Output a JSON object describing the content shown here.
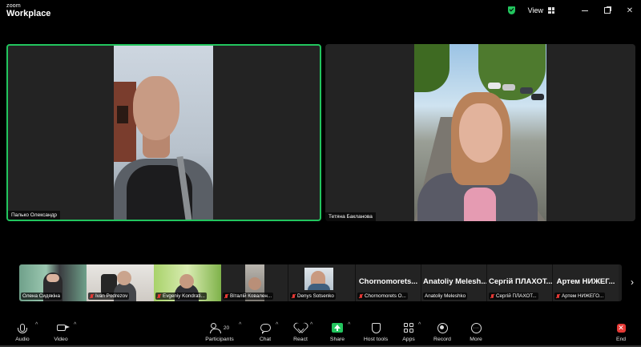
{
  "titlebar": {
    "logo_line1": "zoom",
    "logo_line2": "Workplace",
    "view_label": "View"
  },
  "main_tiles": [
    {
      "name": "Палько Олександр",
      "active": true
    },
    {
      "name": "Тетяна Бакланова",
      "active": false
    }
  ],
  "thumbnails": [
    {
      "label": "Олена Сидякіна",
      "muted": false,
      "has_video": true
    },
    {
      "label": "Ivan Podrezov",
      "muted": true,
      "has_video": true
    },
    {
      "label": "Evgeniy Kondrati...",
      "muted": true,
      "has_video": true
    },
    {
      "label": "Віталій Ковален...",
      "muted": true,
      "has_video": true
    },
    {
      "label": "Denys Sotsenko",
      "muted": true,
      "has_video": true
    },
    {
      "display_name": "Chornomorets...",
      "label": "Chornomorets O...",
      "muted": true,
      "has_video": false
    },
    {
      "display_name": "Anatoliy Melesh...",
      "label": "Anatoliy Meleshko",
      "muted": false,
      "has_video": false
    },
    {
      "display_name": "Сергій ПЛАХОТ...",
      "label": "Сергій ПЛАХОТ...",
      "muted": true,
      "has_video": false
    },
    {
      "display_name": "Артем НИЖЕГ...",
      "label": "Артем НИЖЕГО...",
      "muted": true,
      "has_video": false
    }
  ],
  "toolbar": {
    "audio": "Audio",
    "video": "Video",
    "participants": "Participants",
    "participants_count": "20",
    "chat": "Chat",
    "react": "React",
    "share": "Share",
    "host_tools": "Host tools",
    "apps": "Apps",
    "record": "Record",
    "more": "More",
    "end": "End"
  },
  "colors": {
    "accent_green": "#22c55e",
    "end_red": "#e53935",
    "background": "#000000",
    "tile": "#232323"
  },
  "icons": [
    "security-shield-icon",
    "view-grid-icon",
    "minimize-icon",
    "maximize-icon",
    "close-icon",
    "mic-icon",
    "camera-icon",
    "participants-icon",
    "chat-icon",
    "react-heart-icon",
    "share-screen-icon",
    "host-shield-icon",
    "apps-icon",
    "record-icon",
    "more-icon",
    "end-icon",
    "chevron-right-icon",
    "mic-muted-icon"
  ]
}
